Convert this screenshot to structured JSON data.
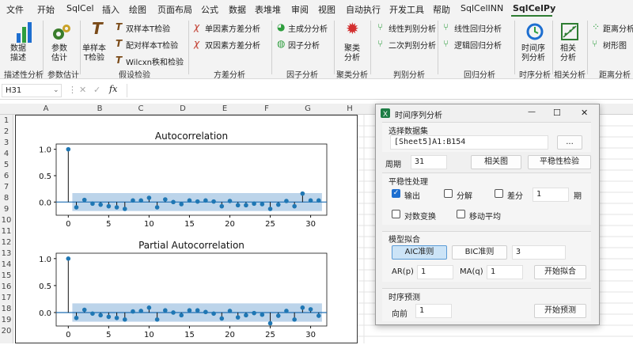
{
  "menubar": {
    "items": [
      "文件",
      "开始",
      "SqlCel",
      "插入",
      "绘图",
      "页面布局",
      "公式",
      "数据",
      "表堆堆",
      "审阅",
      "视图",
      "自动执行",
      "开发工具",
      "帮助",
      "SqlCelINN",
      "SqlCelPy"
    ],
    "active": "SqlCelPy"
  },
  "ribbon": {
    "data_desc": "数据\n描述",
    "param_est": "参数\n估计",
    "single_t": "单样本\nT检验",
    "two_t": "双样本T检验",
    "paired_t": "配对样本T检验",
    "wilcxn": "Wilcxn秩和检验",
    "anova1": "单因素方差分析",
    "anova2": "双因素方差分析",
    "pca": "主成分分析",
    "factor": "因子分析",
    "cluster": "聚类\n分析",
    "lin_disc": "线性判别分析",
    "quad_disc": "二次判别分析",
    "lin_reg": "线性回归分析",
    "logit_reg": "逻辑回归分析",
    "timeseries": "时间序\n列分析",
    "corr": "相关\n分析",
    "dist": "距离分析",
    "tree": "树形图",
    "groups": [
      "描述性分析",
      "参数估计",
      "假设检验",
      "方差分析",
      "因子分析",
      "聚类分析",
      "判别分析",
      "回归分析",
      "时序分析",
      "相关分析",
      "距离分析"
    ]
  },
  "formula_bar": {
    "cell_ref": "H31",
    "fx": "fx",
    "cancel": "✕",
    "ok": "✓"
  },
  "columns": [
    "A",
    "B",
    "C",
    "D",
    "E",
    "F",
    "G",
    "H"
  ],
  "rows": [
    "1",
    "2",
    "3",
    "4",
    "5",
    "6",
    "7",
    "8",
    "9",
    "10",
    "11",
    "12",
    "13",
    "14",
    "15",
    "16",
    "17",
    "18",
    "19",
    "20"
  ],
  "dialog": {
    "title": "时间序列分析",
    "minimize": "—",
    "maximize": "☐",
    "close": "✕",
    "select_data_label": "选择数据集",
    "data_range": "[Sheet5]A1:B154",
    "browse": "...",
    "period_label": "周期",
    "period_value": "31",
    "corr_btn": "相关图",
    "stationary_btn": "平稳性检验",
    "stationary_label": "平稳性处理",
    "output": "输出",
    "decompose": "分解",
    "diff": "差分",
    "diff_value": "1",
    "period_unit": "期",
    "log_transform": "对数变换",
    "moving_avg": "移动平均",
    "fit_label": "模型拟合",
    "aic": "AIC准则",
    "bic": "BIC准则",
    "ic_value": "3",
    "ar_label": "AR(p)",
    "ar_value": "1",
    "ma_label": "MA(q)",
    "ma_value": "1",
    "start_fit": "开始拟合",
    "forecast_label": "时序预测",
    "forward_label": "向前",
    "forward_value": "1",
    "start_forecast": "开始预测"
  },
  "chart_data": [
    {
      "type": "scatter",
      "title": "Autocorrelation",
      "x": [
        0,
        1,
        2,
        3,
        4,
        5,
        6,
        7,
        8,
        9,
        10,
        11,
        12,
        13,
        14,
        15,
        16,
        17,
        18,
        19,
        20,
        21,
        22,
        23,
        24,
        25,
        26,
        27,
        28,
        29,
        30,
        31
      ],
      "y": [
        1.0,
        -0.1,
        0.04,
        -0.03,
        -0.05,
        -0.08,
        -0.1,
        -0.13,
        0.03,
        0.03,
        0.08,
        -0.1,
        0.05,
        0.0,
        -0.04,
        0.03,
        0.01,
        0.03,
        0.01,
        -0.08,
        0.02,
        -0.06,
        -0.06,
        -0.03,
        -0.04,
        -0.13,
        -0.05,
        0.02,
        -0.08,
        0.16,
        0.03,
        0.03
      ],
      "xticks": [
        0,
        5,
        10,
        15,
        20,
        25,
        30
      ],
      "yticks": [
        0.0,
        0.5,
        1.0
      ],
      "ylim": [
        -0.25,
        1.1
      ],
      "xlim": [
        -1.5,
        32
      ]
    },
    {
      "type": "scatter",
      "title": "Partial Autocorrelation",
      "x": [
        0,
        1,
        2,
        3,
        4,
        5,
        6,
        7,
        8,
        9,
        10,
        11,
        12,
        13,
        14,
        15,
        16,
        17,
        18,
        19,
        20,
        21,
        22,
        23,
        24,
        25,
        26,
        27,
        28,
        29,
        30,
        31
      ],
      "y": [
        1.0,
        -0.1,
        0.05,
        -0.02,
        -0.05,
        -0.08,
        -0.1,
        -0.13,
        0.02,
        0.03,
        0.09,
        -0.13,
        0.04,
        0.0,
        -0.05,
        0.04,
        0.04,
        0.01,
        -0.02,
        -0.11,
        0.03,
        -0.09,
        -0.05,
        -0.01,
        -0.04,
        -0.2,
        -0.06,
        0.03,
        -0.13,
        0.09,
        0.06,
        -0.06
      ],
      "xticks": [
        0,
        5,
        10,
        15,
        20,
        25,
        30
      ],
      "yticks": [
        0.0,
        0.5,
        1.0
      ],
      "ylim": [
        -0.25,
        1.1
      ],
      "xlim": [
        -1.5,
        32
      ]
    }
  ]
}
